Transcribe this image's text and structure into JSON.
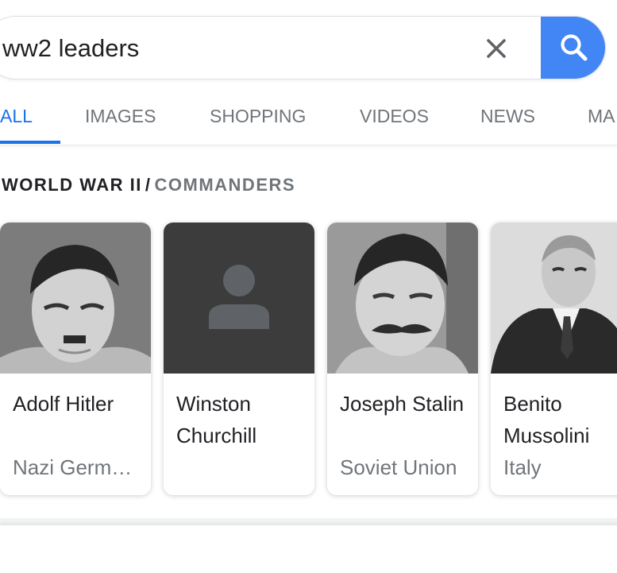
{
  "search": {
    "query": "ww2 leaders"
  },
  "tabs": [
    {
      "label": "ALL",
      "active": true
    },
    {
      "label": "IMAGES",
      "active": false
    },
    {
      "label": "SHOPPING",
      "active": false
    },
    {
      "label": "VIDEOS",
      "active": false
    },
    {
      "label": "NEWS",
      "active": false
    },
    {
      "label": "MA",
      "active": false
    }
  ],
  "knowledge": {
    "parent": "WORLD WAR II",
    "separator": "/",
    "child": "COMMANDERS",
    "cards": [
      {
        "name": "Adolf Hitler",
        "subtitle": "Nazi Germ…"
      },
      {
        "name": "Winston Churchill",
        "subtitle": ""
      },
      {
        "name": "Joseph Stalin",
        "subtitle": "Soviet Union"
      },
      {
        "name": "Benito Mussolini",
        "subtitle": "Italy"
      }
    ]
  },
  "colors": {
    "accent": "#1a73e8",
    "search_button": "#4285f4",
    "placeholder_bg": "#3c3c3c",
    "placeholder_icon": "#5f6368"
  },
  "icons": {
    "clear": "close-icon",
    "search": "search-icon",
    "placeholder": "person-icon"
  }
}
